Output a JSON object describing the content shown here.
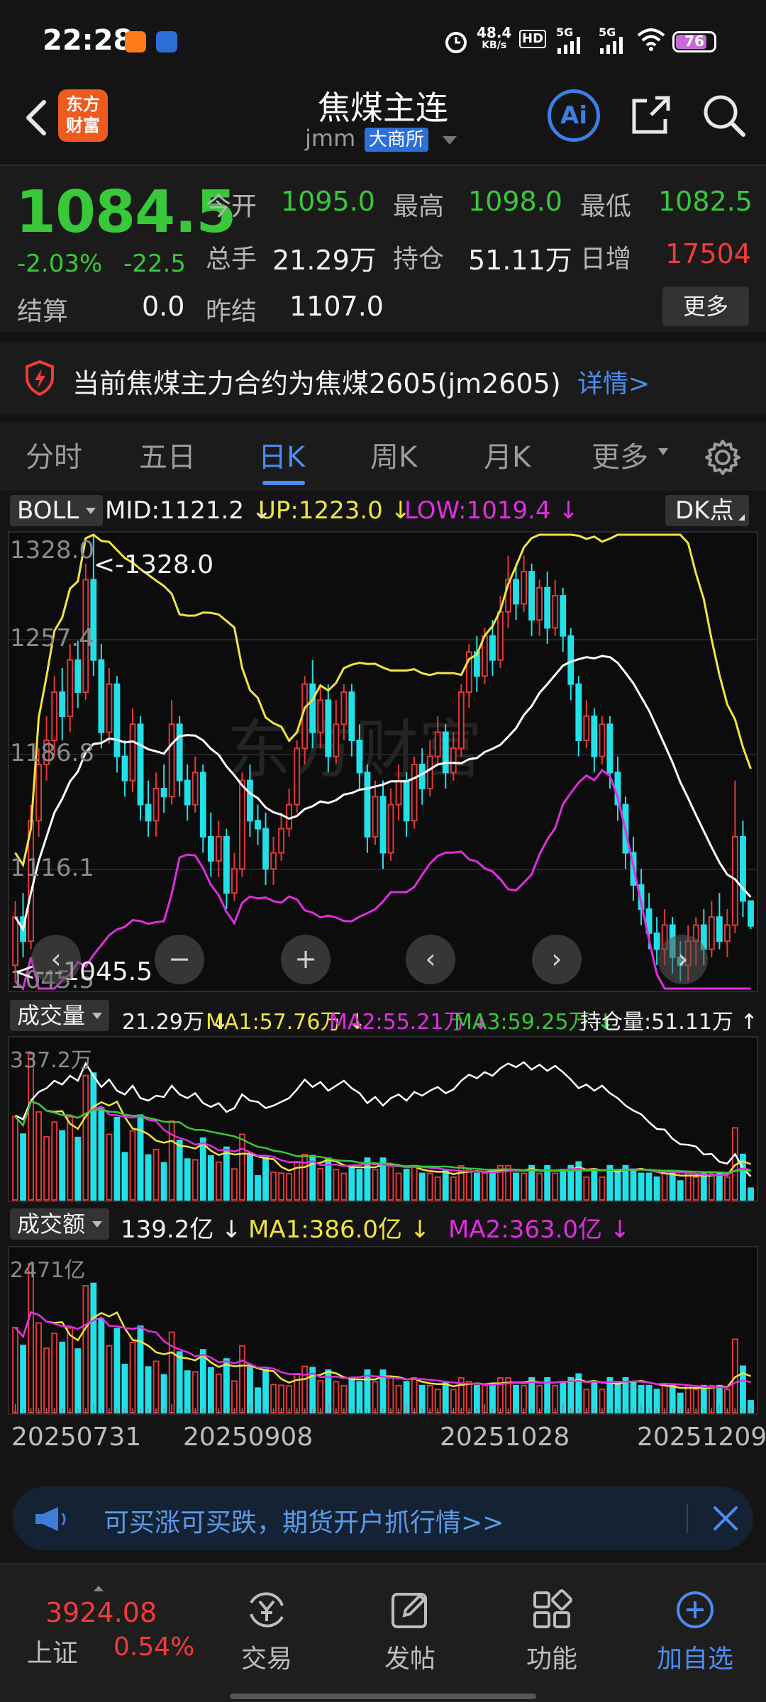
{
  "status_bar": {
    "time": "22:28",
    "net_speed_value": "48.4",
    "net_speed_unit": "KB/s",
    "hd_label": "HD",
    "signal1_label": "5G",
    "signal2_label": "5G",
    "battery_level": "76"
  },
  "header": {
    "logo_line1": "东方",
    "logo_line2": "财富",
    "title": "焦煤主连",
    "code": "jmm",
    "exchange": "大商所",
    "ai_label": "Ai"
  },
  "quote": {
    "price": "1084.5",
    "change_pct": "-2.03%",
    "change_abs": "-22.5",
    "open_label": "今开",
    "open": "1095.0",
    "high_label": "最高",
    "high": "1098.0",
    "low_label": "最低",
    "low": "1082.5",
    "volume_label": "总手",
    "volume": "21.29万",
    "oi_label": "持仓",
    "oi": "51.11万",
    "daily_inc_label": "日增",
    "daily_inc": "17504",
    "settle_label": "结算",
    "settle": "0.0",
    "prev_settle_label": "昨结",
    "prev_settle": "1107.0",
    "more_label": "更多"
  },
  "notice": {
    "text": "当前焦煤主力合约为焦煤2605(jm2605)",
    "link": "详情>"
  },
  "tabs": [
    {
      "label": "分时"
    },
    {
      "label": "五日"
    },
    {
      "label": "日K"
    },
    {
      "label": "周K"
    },
    {
      "label": "月K"
    },
    {
      "label": "更多"
    }
  ],
  "main_chart": {
    "indicator": "BOLL",
    "mid": "MID:1121.2 ↓",
    "up": "UP:1223.0 ↓",
    "low": "LOW:1019.4 ↓",
    "dk_label": "DK点",
    "y_labels": [
      "1328.0",
      "1257.4",
      "1186.8",
      "1116.1",
      "1045.5"
    ],
    "max_marker": "<-1328.0",
    "min_marker": "<---1045.5",
    "colors": {
      "up": "#e23838",
      "down": "#22e0e8",
      "mid": "#ffffff",
      "upper": "#f0e442",
      "lower": "#e02ee0"
    }
  },
  "volume_chart": {
    "indicator": "成交量",
    "value": "21.29万 ↓",
    "ma1": "MA1:57.76万 ↓",
    "ma2": "MA2:55.21万 ↓",
    "ma3": "MA3:59.25万 ↓",
    "oi": "持仓量:51.11万 ↑",
    "y_label": "337.2万"
  },
  "amount_chart": {
    "indicator": "成交额",
    "value": "139.2亿 ↓",
    "ma1": "MA1:386.0亿 ↓",
    "ma2": "MA2:363.0亿 ↓",
    "y_label": "2471亿"
  },
  "x_dates": [
    "20250731",
    "20250908",
    "20251028",
    "20251209"
  ],
  "chart_data": {
    "type": "candlestick",
    "title": "焦煤主连 日K",
    "ylim": [
      1045.5,
      1328.0
    ],
    "candles": [
      {
        "o": 1060,
        "c": 1090,
        "h": 1100,
        "l": 1050
      },
      {
        "o": 1090,
        "c": 1075,
        "h": 1105,
        "l": 1065
      },
      {
        "o": 1075,
        "c": 1150,
        "h": 1160,
        "l": 1070
      },
      {
        "o": 1150,
        "c": 1185,
        "h": 1195,
        "l": 1140
      },
      {
        "o": 1185,
        "c": 1200,
        "h": 1215,
        "l": 1175
      },
      {
        "o": 1200,
        "c": 1230,
        "h": 1240,
        "l": 1190
      },
      {
        "o": 1230,
        "c": 1215,
        "h": 1245,
        "l": 1200
      },
      {
        "o": 1215,
        "c": 1250,
        "h": 1260,
        "l": 1205
      },
      {
        "o": 1250,
        "c": 1230,
        "h": 1262,
        "l": 1220
      },
      {
        "o": 1230,
        "c": 1300,
        "h": 1310,
        "l": 1225
      },
      {
        "o": 1300,
        "c": 1250,
        "h": 1328,
        "l": 1240
      },
      {
        "o": 1250,
        "c": 1205,
        "h": 1260,
        "l": 1195
      },
      {
        "o": 1205,
        "c": 1235,
        "h": 1245,
        "l": 1198
      },
      {
        "o": 1235,
        "c": 1190,
        "h": 1240,
        "l": 1180
      },
      {
        "o": 1190,
        "c": 1175,
        "h": 1200,
        "l": 1165
      },
      {
        "o": 1175,
        "c": 1210,
        "h": 1220,
        "l": 1168
      },
      {
        "o": 1210,
        "c": 1160,
        "h": 1215,
        "l": 1150
      },
      {
        "o": 1160,
        "c": 1150,
        "h": 1175,
        "l": 1140
      },
      {
        "o": 1150,
        "c": 1170,
        "h": 1180,
        "l": 1140
      },
      {
        "o": 1170,
        "c": 1165,
        "h": 1185,
        "l": 1155
      },
      {
        "o": 1165,
        "c": 1210,
        "h": 1225,
        "l": 1160
      },
      {
        "o": 1210,
        "c": 1175,
        "h": 1215,
        "l": 1165
      },
      {
        "o": 1175,
        "c": 1160,
        "h": 1185,
        "l": 1150
      },
      {
        "o": 1160,
        "c": 1180,
        "h": 1190,
        "l": 1155
      },
      {
        "o": 1180,
        "c": 1140,
        "h": 1185,
        "l": 1130
      },
      {
        "o": 1140,
        "c": 1125,
        "h": 1155,
        "l": 1115
      },
      {
        "o": 1125,
        "c": 1140,
        "h": 1150,
        "l": 1115
      },
      {
        "o": 1140,
        "c": 1105,
        "h": 1145,
        "l": 1095
      },
      {
        "o": 1105,
        "c": 1120,
        "h": 1130,
        "l": 1100
      },
      {
        "o": 1120,
        "c": 1175,
        "h": 1180,
        "l": 1115
      },
      {
        "o": 1175,
        "c": 1150,
        "h": 1185,
        "l": 1140
      },
      {
        "o": 1150,
        "c": 1145,
        "h": 1160,
        "l": 1135
      },
      {
        "o": 1145,
        "c": 1120,
        "h": 1155,
        "l": 1110
      },
      {
        "o": 1120,
        "c": 1130,
        "h": 1140,
        "l": 1110
      },
      {
        "o": 1130,
        "c": 1145,
        "h": 1155,
        "l": 1125
      },
      {
        "o": 1145,
        "c": 1160,
        "h": 1170,
        "l": 1140
      },
      {
        "o": 1160,
        "c": 1195,
        "h": 1200,
        "l": 1155
      },
      {
        "o": 1195,
        "c": 1235,
        "h": 1240,
        "l": 1185
      },
      {
        "o": 1235,
        "c": 1205,
        "h": 1250,
        "l": 1195
      },
      {
        "o": 1205,
        "c": 1225,
        "h": 1235,
        "l": 1195
      },
      {
        "o": 1225,
        "c": 1190,
        "h": 1235,
        "l": 1180
      },
      {
        "o": 1190,
        "c": 1210,
        "h": 1225,
        "l": 1185
      },
      {
        "o": 1210,
        "c": 1230,
        "h": 1235,
        "l": 1200
      },
      {
        "o": 1230,
        "c": 1200,
        "h": 1235,
        "l": 1190
      },
      {
        "o": 1200,
        "c": 1180,
        "h": 1210,
        "l": 1170
      },
      {
        "o": 1180,
        "c": 1140,
        "h": 1185,
        "l": 1130
      },
      {
        "o": 1140,
        "c": 1165,
        "h": 1175,
        "l": 1135
      },
      {
        "o": 1165,
        "c": 1130,
        "h": 1175,
        "l": 1120
      },
      {
        "o": 1130,
        "c": 1160,
        "h": 1170,
        "l": 1125
      },
      {
        "o": 1160,
        "c": 1175,
        "h": 1185,
        "l": 1150
      },
      {
        "o": 1175,
        "c": 1150,
        "h": 1180,
        "l": 1140
      },
      {
        "o": 1150,
        "c": 1185,
        "h": 1190,
        "l": 1145
      },
      {
        "o": 1185,
        "c": 1170,
        "h": 1195,
        "l": 1160
      },
      {
        "o": 1170,
        "c": 1190,
        "h": 1200,
        "l": 1165
      },
      {
        "o": 1190,
        "c": 1205,
        "h": 1215,
        "l": 1185
      },
      {
        "o": 1205,
        "c": 1180,
        "h": 1210,
        "l": 1170
      },
      {
        "o": 1180,
        "c": 1195,
        "h": 1205,
        "l": 1175
      },
      {
        "o": 1195,
        "c": 1230,
        "h": 1235,
        "l": 1190
      },
      {
        "o": 1230,
        "c": 1255,
        "h": 1260,
        "l": 1220
      },
      {
        "o": 1255,
        "c": 1240,
        "h": 1265,
        "l": 1230
      },
      {
        "o": 1240,
        "c": 1265,
        "h": 1270,
        "l": 1235
      },
      {
        "o": 1265,
        "c": 1250,
        "h": 1275,
        "l": 1240
      },
      {
        "o": 1250,
        "c": 1280,
        "h": 1290,
        "l": 1245
      },
      {
        "o": 1280,
        "c": 1300,
        "h": 1315,
        "l": 1270
      },
      {
        "o": 1300,
        "c": 1285,
        "h": 1310,
        "l": 1275
      },
      {
        "o": 1285,
        "c": 1305,
        "h": 1315,
        "l": 1280
      },
      {
        "o": 1305,
        "c": 1275,
        "h": 1310,
        "l": 1265
      },
      {
        "o": 1275,
        "c": 1295,
        "h": 1300,
        "l": 1265
      },
      {
        "o": 1295,
        "c": 1270,
        "h": 1305,
        "l": 1260
      },
      {
        "o": 1270,
        "c": 1290,
        "h": 1300,
        "l": 1265
      },
      {
        "o": 1290,
        "c": 1265,
        "h": 1295,
        "l": 1255
      },
      {
        "o": 1265,
        "c": 1235,
        "h": 1270,
        "l": 1225
      },
      {
        "o": 1235,
        "c": 1200,
        "h": 1240,
        "l": 1190
      },
      {
        "o": 1200,
        "c": 1215,
        "h": 1225,
        "l": 1195
      },
      {
        "o": 1215,
        "c": 1190,
        "h": 1220,
        "l": 1180
      },
      {
        "o": 1190,
        "c": 1210,
        "h": 1215,
        "l": 1185
      },
      {
        "o": 1210,
        "c": 1180,
        "h": 1215,
        "l": 1170
      },
      {
        "o": 1180,
        "c": 1160,
        "h": 1190,
        "l": 1150
      },
      {
        "o": 1160,
        "c": 1130,
        "h": 1165,
        "l": 1120
      },
      {
        "o": 1130,
        "c": 1110,
        "h": 1140,
        "l": 1100
      },
      {
        "o": 1110,
        "c": 1095,
        "h": 1120,
        "l": 1085
      },
      {
        "o": 1095,
        "c": 1080,
        "h": 1105,
        "l": 1070
      },
      {
        "o": 1080,
        "c": 1070,
        "h": 1090,
        "l": 1060
      },
      {
        "o": 1070,
        "c": 1085,
        "h": 1095,
        "l": 1060
      },
      {
        "o": 1085,
        "c": 1065,
        "h": 1090,
        "l": 1055
      },
      {
        "o": 1065,
        "c": 1060,
        "h": 1075,
        "l": 1050
      },
      {
        "o": 1060,
        "c": 1075,
        "h": 1085,
        "l": 1050
      },
      {
        "o": 1075,
        "c": 1085,
        "h": 1090,
        "l": 1060
      },
      {
        "o": 1085,
        "c": 1070,
        "h": 1095,
        "l": 1060
      },
      {
        "o": 1070,
        "c": 1090,
        "h": 1100,
        "l": 1065
      },
      {
        "o": 1090,
        "c": 1075,
        "h": 1105,
        "l": 1070
      },
      {
        "o": 1075,
        "c": 1085,
        "h": 1095,
        "l": 1065
      },
      {
        "o": 1085,
        "c": 1140,
        "h": 1175,
        "l": 1080
      },
      {
        "o": 1140,
        "c": 1100,
        "h": 1150,
        "l": 1090
      },
      {
        "o": 1100,
        "c": 1084.5,
        "h": 1098,
        "l": 1082.5
      }
    ]
  },
  "ad": {
    "text": "可买涨可买跌，期货开户抓行情>>"
  },
  "bottom_nav": {
    "index_value": "3924.08",
    "index_name": "上证",
    "index_change": "0.54%",
    "items": [
      {
        "label": "交易"
      },
      {
        "label": "发帖"
      },
      {
        "label": "功能"
      },
      {
        "label": "加自选"
      }
    ]
  }
}
